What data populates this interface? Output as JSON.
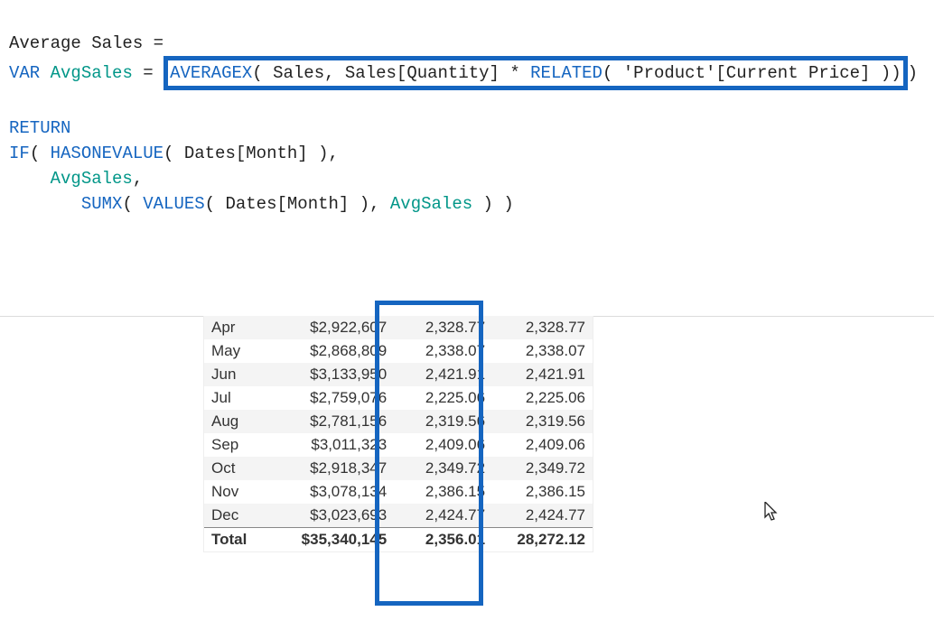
{
  "formula": {
    "line1": {
      "measure_name": "Average Sales",
      "equals": "="
    },
    "line2": {
      "var_kw": "VAR",
      "var_name": "AvgSales",
      "assign": "=",
      "func_avgx": "AVERAGEX",
      "paren_open": "(",
      "arg1": " Sales, Sales[Quantity] * ",
      "func_related": "RELATED",
      "arg2": "( 'Product'[Current Price] )",
      "paren_close1": ")",
      "paren_close2": ")"
    },
    "line4": {
      "return_kw": "RETURN"
    },
    "line5": {
      "if_kw": "IF",
      "paren_open": "(",
      "hasonevalue_kw": "HASONEVALUE",
      "arg": "( Dates[Month] ),"
    },
    "line6": {
      "avgsales": "AvgSales",
      "comma": ","
    },
    "line7": {
      "sumx_kw": "SUMX",
      "open": "(",
      "values_kw": "VALUES",
      "arg1": "( Dates[Month] ), ",
      "avgsales": "AvgSales",
      "close": " ) )"
    }
  },
  "table": {
    "rows": [
      {
        "month": "Apr",
        "sales": "$2,922,607",
        "avg1": "2,328.77",
        "avg2": "2,328.77"
      },
      {
        "month": "May",
        "sales": "$2,868,809",
        "avg1": "2,338.07",
        "avg2": "2,338.07"
      },
      {
        "month": "Jun",
        "sales": "$3,133,950",
        "avg1": "2,421.91",
        "avg2": "2,421.91"
      },
      {
        "month": "Jul",
        "sales": "$2,759,076",
        "avg1": "2,225.06",
        "avg2": "2,225.06"
      },
      {
        "month": "Aug",
        "sales": "$2,781,156",
        "avg1": "2,319.56",
        "avg2": "2,319.56"
      },
      {
        "month": "Sep",
        "sales": "$3,011,323",
        "avg1": "2,409.06",
        "avg2": "2,409.06"
      },
      {
        "month": "Oct",
        "sales": "$2,918,347",
        "avg1": "2,349.72",
        "avg2": "2,349.72"
      },
      {
        "month": "Nov",
        "sales": "$3,078,134",
        "avg1": "2,386.15",
        "avg2": "2,386.15"
      },
      {
        "month": "Dec",
        "sales": "$3,023,693",
        "avg1": "2,424.77",
        "avg2": "2,424.77"
      }
    ],
    "total": {
      "label": "Total",
      "sales": "$35,340,145",
      "avg1": "2,356.01",
      "avg2": "28,272.12"
    }
  }
}
